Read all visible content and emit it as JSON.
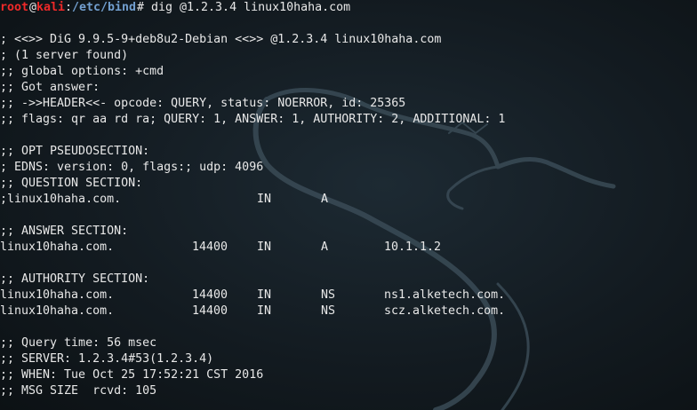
{
  "prompt": {
    "user": "root",
    "at": "@",
    "host": "kali",
    "sep": ":",
    "path": "/etc/bind",
    "symbol": "#",
    "command": " dig @1.2.3.4 linux10haha.com"
  },
  "output": {
    "banner": "; <<>> DiG 9.9.5-9+deb8u2-Debian <<>> @1.2.3.4 linux10haha.com",
    "servers_found": "; (1 server found)",
    "global_options": ";; global options: +cmd",
    "got_answer": ";; Got answer:",
    "header": ";; ->>HEADER<<- opcode: QUERY, status: NOERROR, id: 25365",
    "flags": ";; flags: qr aa rd ra; QUERY: 1, ANSWER: 1, AUTHORITY: 2, ADDITIONAL: 1",
    "opt_title": ";; OPT PSEUDOSECTION:",
    "edns": "; EDNS: version: 0, flags:; udp: 4096",
    "question_title": ";; QUESTION SECTION:",
    "question": {
      "name": ";linux10haha.com.",
      "class": "IN",
      "type": "A"
    },
    "answer_title": ";; ANSWER SECTION:",
    "answer": {
      "name": "linux10haha.com.",
      "ttl": "14400",
      "class": "IN",
      "type": "A",
      "data": "10.1.1.2"
    },
    "authority_title": ";; AUTHORITY SECTION:",
    "authority": [
      {
        "name": "linux10haha.com.",
        "ttl": "14400",
        "class": "IN",
        "type": "NS",
        "data": "ns1.alketech.com."
      },
      {
        "name": "linux10haha.com.",
        "ttl": "14400",
        "class": "IN",
        "type": "NS",
        "data": "scz.alketech.com."
      }
    ],
    "query_time": ";; Query time: 56 msec",
    "server": ";; SERVER: 1.2.3.4#53(1.2.3.4)",
    "when": ";; WHEN: Tue Oct 25 17:52:21 CST 2016",
    "msg_size": ";; MSG SIZE  rcvd: 105"
  },
  "background": {
    "logo": "kali-dragon-icon",
    "color": "#131b21"
  }
}
